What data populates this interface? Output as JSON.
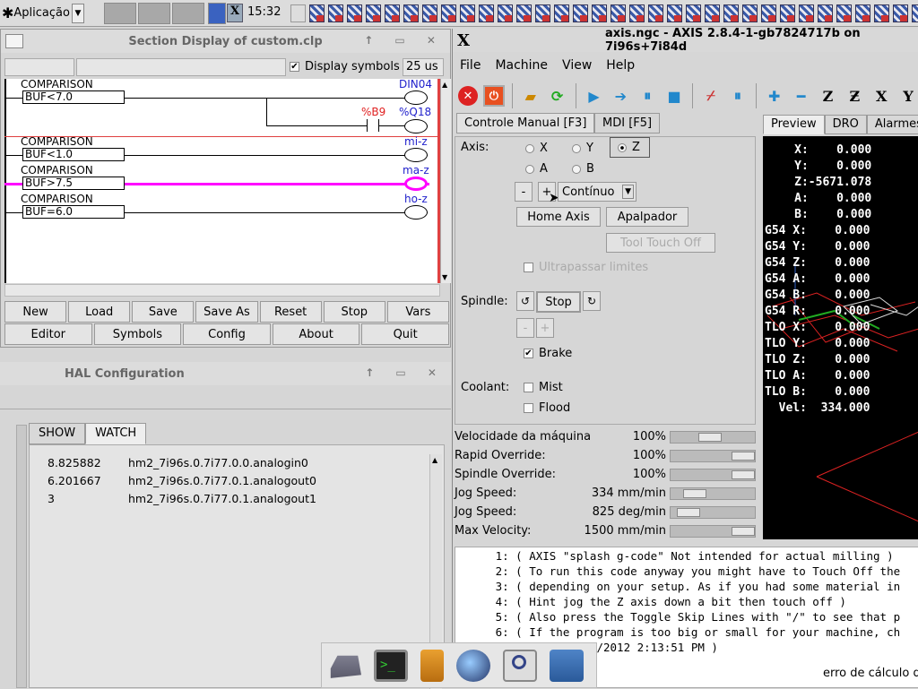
{
  "taskbar": {
    "app_menu_label": "Aplicação",
    "clock": "15:32",
    "axis_task_label": "X"
  },
  "ladder": {
    "title": "Section Display of custom.clp",
    "display_symbols_label": "Display symbols",
    "display_symbols_checked": true,
    "period_value": "25 us",
    "rungs": [
      {
        "label": "COMPARISON",
        "expr": "BUF<7.0",
        "coil": "DIN04"
      },
      {
        "label": "COMPARISON",
        "expr": "BUF<1.0",
        "coil": "mi-z"
      },
      {
        "label": "COMPARISON",
        "expr": "BUF>7.5",
        "coil": "ma-z"
      },
      {
        "label": "COMPARISON",
        "expr": "BUF=6.0",
        "coil": "ho-z"
      }
    ],
    "contact_label": "%B9",
    "contact_coil": "%Q18",
    "buttons_row1": [
      "New",
      "Load",
      "Save",
      "Save As",
      "Reset",
      "Stop",
      "Vars"
    ],
    "buttons_row2": [
      "Editor",
      "Symbols",
      "Config",
      "About",
      "Quit"
    ],
    "highlight_color": "#ff00ff"
  },
  "hal": {
    "title": "HAL Configuration",
    "tabs": [
      "SHOW",
      "WATCH"
    ],
    "active_tab": "WATCH",
    "watch_rows": [
      {
        "value": "8.825882",
        "pin": "hm2_7i96s.0.7i77.0.0.analogin0"
      },
      {
        "value": "6.201667",
        "pin": "hm2_7i96s.0.7i77.0.1.analogout0"
      },
      {
        "value": "3",
        "pin": "hm2_7i96s.0.7i77.0.1.analogout1"
      }
    ]
  },
  "axis": {
    "title": "axis.ngc - AXIS 2.8.4-1-gb7824717b on 7i96s+7i84d",
    "menu": [
      "File",
      "Machine",
      "View",
      "Help"
    ],
    "manual_tab": "Controle Manual [F3]",
    "mdi_tab": "MDI [F5]",
    "axis_label": "Axis:",
    "axes": [
      "X",
      "Y",
      "Z",
      "A",
      "B"
    ],
    "selected_axis": "Z",
    "jog_minus": "-",
    "jog_plus": "+",
    "jog_mode": "Contínuo",
    "home_button": "Home Axis",
    "probe_button": "Apalpador",
    "touchoff_button": "Tool Touch Off",
    "override_limits": "Ultrapassar limites",
    "spindle_label": "Spindle:",
    "spindle_stop": "Stop",
    "brake_label": "Brake",
    "coolant_label": "Coolant:",
    "mist_label": "Mist",
    "flood_label": "Flood",
    "sliders": [
      {
        "label": "Velocidade da máquina",
        "value": "100%",
        "level": 0.45
      },
      {
        "label": "Rapid Override:",
        "value": "100%",
        "level": 1.0
      },
      {
        "label": "Spindle Override:",
        "value": "100%",
        "level": 1.0
      },
      {
        "label": "Jog Speed:",
        "value": "334 mm/min",
        "level": 0.2
      },
      {
        "label": "Jog Speed:",
        "value": "825 deg/min",
        "level": 0.1
      },
      {
        "label": "Max Velocity:",
        "value": "1500 mm/min",
        "level": 1.0
      }
    ],
    "preview_tabs": [
      "Preview",
      "DRO",
      "Alarmes"
    ],
    "dro": [
      "   X:    0.000",
      "   Y:    0.000",
      "   Z:-5671.078",
      "   A:    0.000",
      "   B:    0.000",
      "G54 X:    0.000",
      "G54 Y:    0.000",
      "G54 Z:    0.000",
      "G54 A:    0.000",
      "G54 B:    0.000",
      "G54 R:    0.000",
      "TLO X:    0.000",
      "TLO Y:    0.000",
      "TLO Z:    0.000",
      "TLO A:    0.000",
      "TLO B:    0.000",
      "  Vel:  334.000"
    ],
    "gcode": [
      "   1: ( AXIS \"splash g-code\" Not intended for actual milling )",
      "   2: ( To run this code anyway you might have to Touch Off the",
      "   3: ( depending on your setup. As if you had some material in",
      "   4: ( Hint jog the Z axis down a bit then touch off )",
      "   5: ( Also press the Toggle Skip Lines with \"/\" to see that p",
      "   6: ( If the program is too big or small for your machine, ch",
      "   7: ( Linux 19/1/2012 2:13:51 PM )"
    ],
    "status": "erro de cálculo d"
  }
}
